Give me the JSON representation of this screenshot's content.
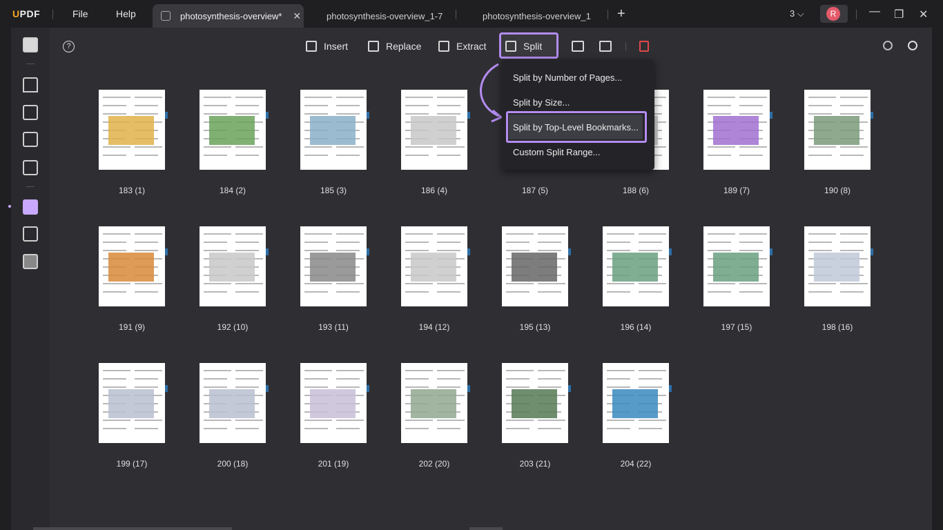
{
  "app": {
    "logo_u": "U",
    "logo_rest": "PDF"
  },
  "menu": {
    "file": "File",
    "help": "Help"
  },
  "tabs": [
    {
      "label": "photosynthesis-overview*",
      "active": true
    },
    {
      "label": "photosynthesis-overview_1-7",
      "active": false
    },
    {
      "label": "photosynthesis-overview_1",
      "active": false
    }
  ],
  "window": {
    "count": "3",
    "avatar_letter": "R",
    "minimize": "—",
    "maximize": "❐",
    "close": "✕",
    "add_tab": "+"
  },
  "toolbar": {
    "insert": "Insert",
    "replace": "Replace",
    "extract": "Extract",
    "split": "Split"
  },
  "split_menu": {
    "item1": "Split by Number of Pages...",
    "item2": "Split by Size...",
    "item3": "Split by Top-Level Bookmarks...",
    "item4": "Custom Split Range..."
  },
  "pages": [
    "183 (1)",
    "184 (2)",
    "185 (3)",
    "186 (4)",
    "187 (5)",
    "188 (6)",
    "189 (7)",
    "190 (8)",
    "191 (9)",
    "192 (10)",
    "193 (11)",
    "194 (12)",
    "195 (13)",
    "196 (14)",
    "197 (15)",
    "198 (16)",
    "199 (17)",
    "200 (18)",
    "201 (19)",
    "202 (20)",
    "203 (21)",
    "204 (22)"
  ],
  "colors": {
    "accent": "#b48cf0",
    "brand": "#f5a623",
    "delete": "#e0484c"
  }
}
